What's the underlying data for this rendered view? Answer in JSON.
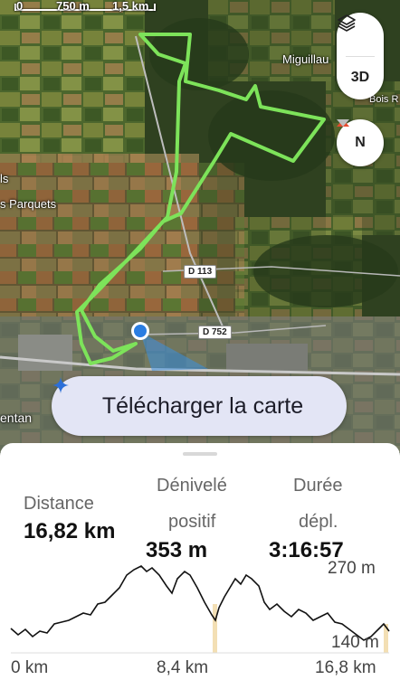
{
  "map": {
    "scale_zero": "0",
    "scale_mid": "750 m",
    "scale_end": "1,5 km",
    "labels": [
      "Miguillau",
      "s Parquets",
      "Bois R",
      "ls",
      "entan"
    ],
    "roads": [
      "D 113",
      "D 752"
    ],
    "colors": {
      "route": "#7de35a",
      "location": "#2a7de1"
    }
  },
  "controls": {
    "layers_icon": "layers-icon",
    "three_d_label": "3D",
    "compass_label": "N"
  },
  "download_button": {
    "label": "Télécharger la carte",
    "icon": "sparkle-icon"
  },
  "stats": {
    "distance": {
      "label": "Distance",
      "value": "16,82 km"
    },
    "elevation": {
      "label_line1": "Dénivelé",
      "label_line2": "positif",
      "value": "353 m"
    },
    "duration": {
      "label_line1": "Durée",
      "label_line2": "dépl.",
      "value": "3:16:57"
    }
  },
  "profile": {
    "y_max_label": "270 m",
    "y_min_label": "140 m",
    "x_labels": [
      "0 km",
      "8,4 km",
      "16,8 km"
    ]
  }
}
